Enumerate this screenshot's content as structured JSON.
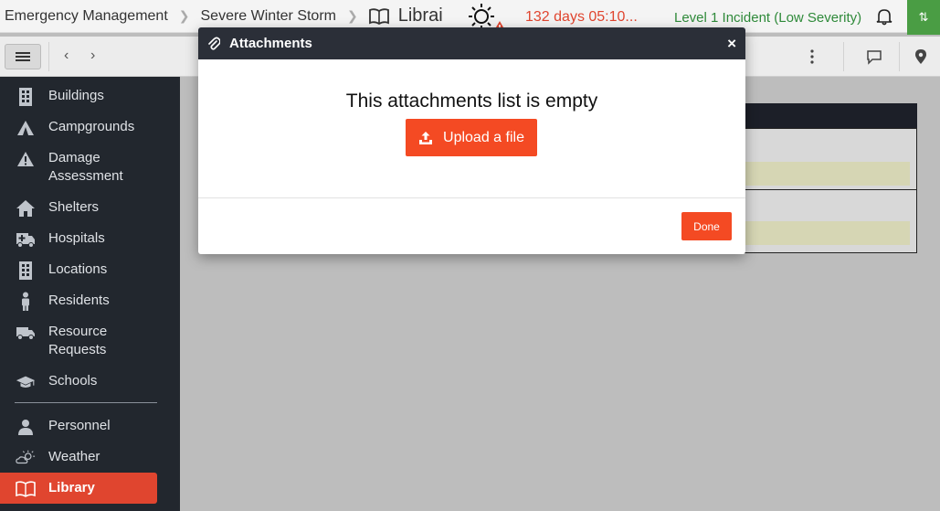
{
  "topbar": {
    "breadcrumb": [
      "Emergency Management",
      "Severe Winter Storm",
      "Librai"
    ],
    "timer": "132 days 05:10...",
    "incident_level": "Level 1 Incident (Low Severity)"
  },
  "sidebar": {
    "items": [
      {
        "label": "Buildings",
        "icon": "building-icon"
      },
      {
        "label": "Campgrounds",
        "icon": "tent-icon"
      },
      {
        "label": "Damage\nAssessment",
        "icon": "warning-icon"
      },
      {
        "label": "Shelters",
        "icon": "house-icon"
      },
      {
        "label": "Hospitals",
        "icon": "ambulance-icon"
      },
      {
        "label": "Locations",
        "icon": "building-icon"
      },
      {
        "label": "Residents",
        "icon": "person-icon"
      },
      {
        "label": "Resource\nRequests",
        "icon": "truck-icon"
      },
      {
        "label": "Schools",
        "icon": "graduation-cap-icon"
      },
      {
        "label": "Personnel",
        "icon": "user-icon"
      },
      {
        "label": "Weather",
        "icon": "weather-icon"
      },
      {
        "label": "Library",
        "icon": "book-icon"
      }
    ],
    "active_item": "Library"
  },
  "modal": {
    "title": "Attachments",
    "close_label": "×",
    "empty_message": "This attachments list is empty",
    "upload_label": "Upload a file",
    "done_label": "Done"
  },
  "colors": {
    "accent": "#f44a23",
    "sidebar_bg": "#22272e",
    "modal_header": "#2b2f38",
    "timer": "#e0452f",
    "level": "#2f8a3a",
    "green_button": "#4a9d44"
  }
}
